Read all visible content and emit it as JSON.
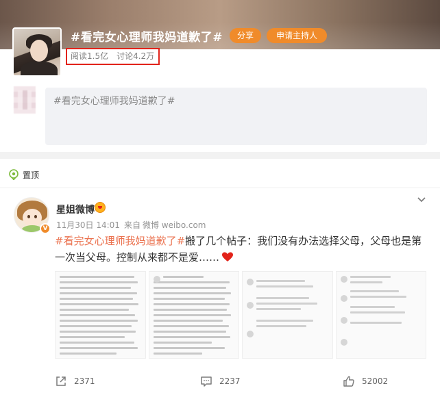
{
  "topic": {
    "title": "#看完女心理师我妈道歉了#",
    "share_label": "分享",
    "host_label": "申请主持人",
    "reads": "阅读1.5亿",
    "discussions": "讨论4.2万"
  },
  "composer": {
    "prefill": "#看完女心理师我妈道歉了#"
  },
  "post": {
    "pinned_label": "置顶",
    "author": "星姐微博",
    "date": "11月30日 14:01",
    "source_prefix": "来自",
    "source": "微博 weibo.com",
    "topic_link": "#看完女心理师我妈道歉了#",
    "body": "搬了几个帖子：我们没有办法选择父母，父母也是第一次当父母。控制从来都不是爱……",
    "reposts": "2371",
    "comments": "2237",
    "likes": "52002"
  },
  "colors": {
    "brand_orange": "#f08b2a",
    "topic_link": "#eb7350",
    "highlight_red": "#e2231a"
  },
  "icons": {
    "pin": "pin-icon",
    "chevron": "chevron-down-icon",
    "repost": "repost-icon",
    "comment": "comment-icon",
    "like": "like-icon",
    "heart": "heart-icon",
    "verified": "verified-badge-icon"
  }
}
